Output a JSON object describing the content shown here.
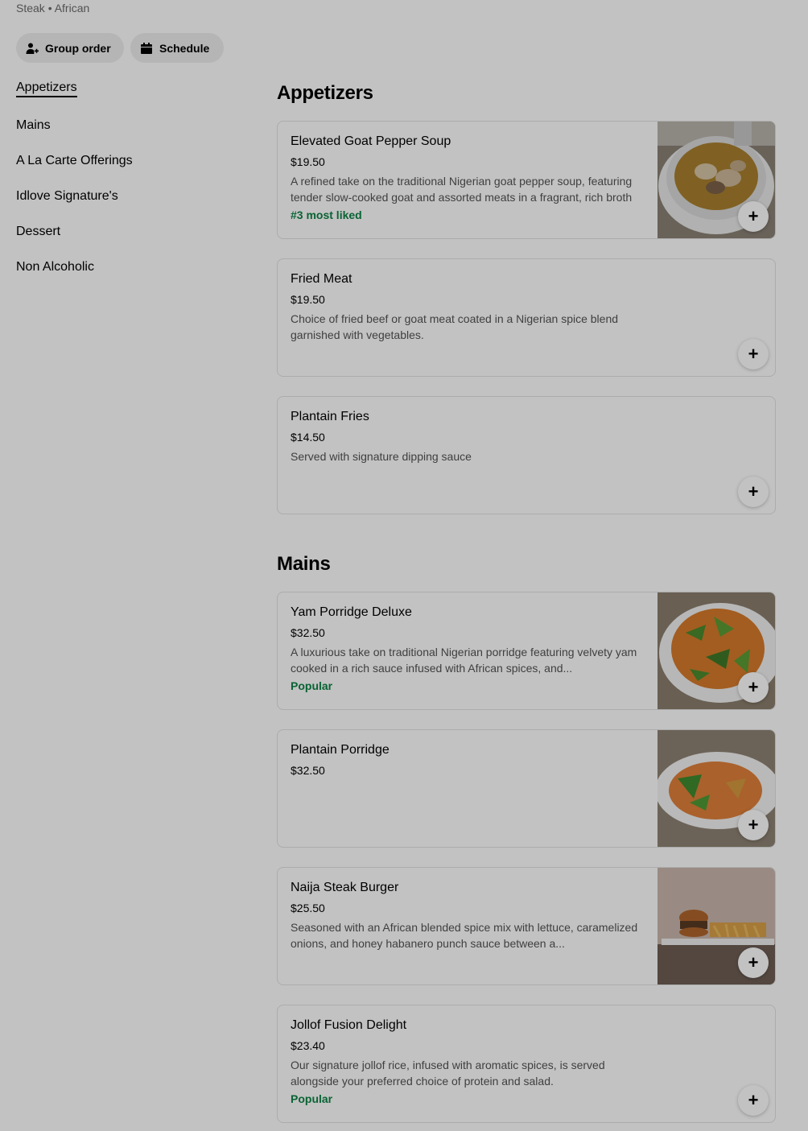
{
  "store": {
    "subtitle": "Steak • African"
  },
  "actions": {
    "group_order": "Group order",
    "schedule": "Schedule"
  },
  "sidebar": {
    "items": [
      {
        "label": "Appetizers",
        "active": true
      },
      {
        "label": "Mains"
      },
      {
        "label": "A La Carte Offerings"
      },
      {
        "label": "Idlove Signature's"
      },
      {
        "label": "Dessert"
      },
      {
        "label": "Non Alcoholic"
      }
    ]
  },
  "sections": [
    {
      "title": "Appetizers",
      "items": [
        {
          "name": "Elevated Goat Pepper Soup",
          "price": "$19.50",
          "description": "A refined take on the traditional Nigerian goat pepper soup, featuring tender slow-cooked goat and assorted meats in a fragrant, rich broth",
          "tag": "#3 most liked",
          "image": "goat-pepper-soup"
        },
        {
          "name": "Fried Meat",
          "price": "$19.50",
          "description": "Choice of fried beef or goat meat coated in a Nigerian spice blend garnished with vegetables."
        },
        {
          "name": "Plantain Fries",
          "price": "$14.50",
          "description": "Served with signature dipping sauce"
        }
      ]
    },
    {
      "title": "Mains",
      "items": [
        {
          "name": "Yam Porridge Deluxe",
          "price": "$32.50",
          "description": "A luxurious take on traditional Nigerian porridge featuring velvety yam cooked in a rich sauce infused with African spices, and...",
          "tag": "Popular",
          "image": "yam-porridge"
        },
        {
          "name": "Plantain Porridge",
          "price": "$32.50",
          "image": "plantain-porridge"
        },
        {
          "name": "Naija Steak Burger",
          "price": "$25.50",
          "description": "Seasoned with an African blended spice mix with lettuce, caramelized onions, and honey habanero punch sauce between a...",
          "image": "steak-burger"
        },
        {
          "name": "Jollof Fusion Delight",
          "price": "$23.40",
          "description": "Our signature jollof rice, infused with aromatic spices, is served alongside your preferred choice of protein and salad.",
          "tag": "Popular"
        }
      ]
    }
  ],
  "add_symbol": "+",
  "colors": {
    "tag": "#0e8345",
    "pill_bg": "#eeeeee",
    "overlay": "rgba(0,0,0,0.24)"
  }
}
